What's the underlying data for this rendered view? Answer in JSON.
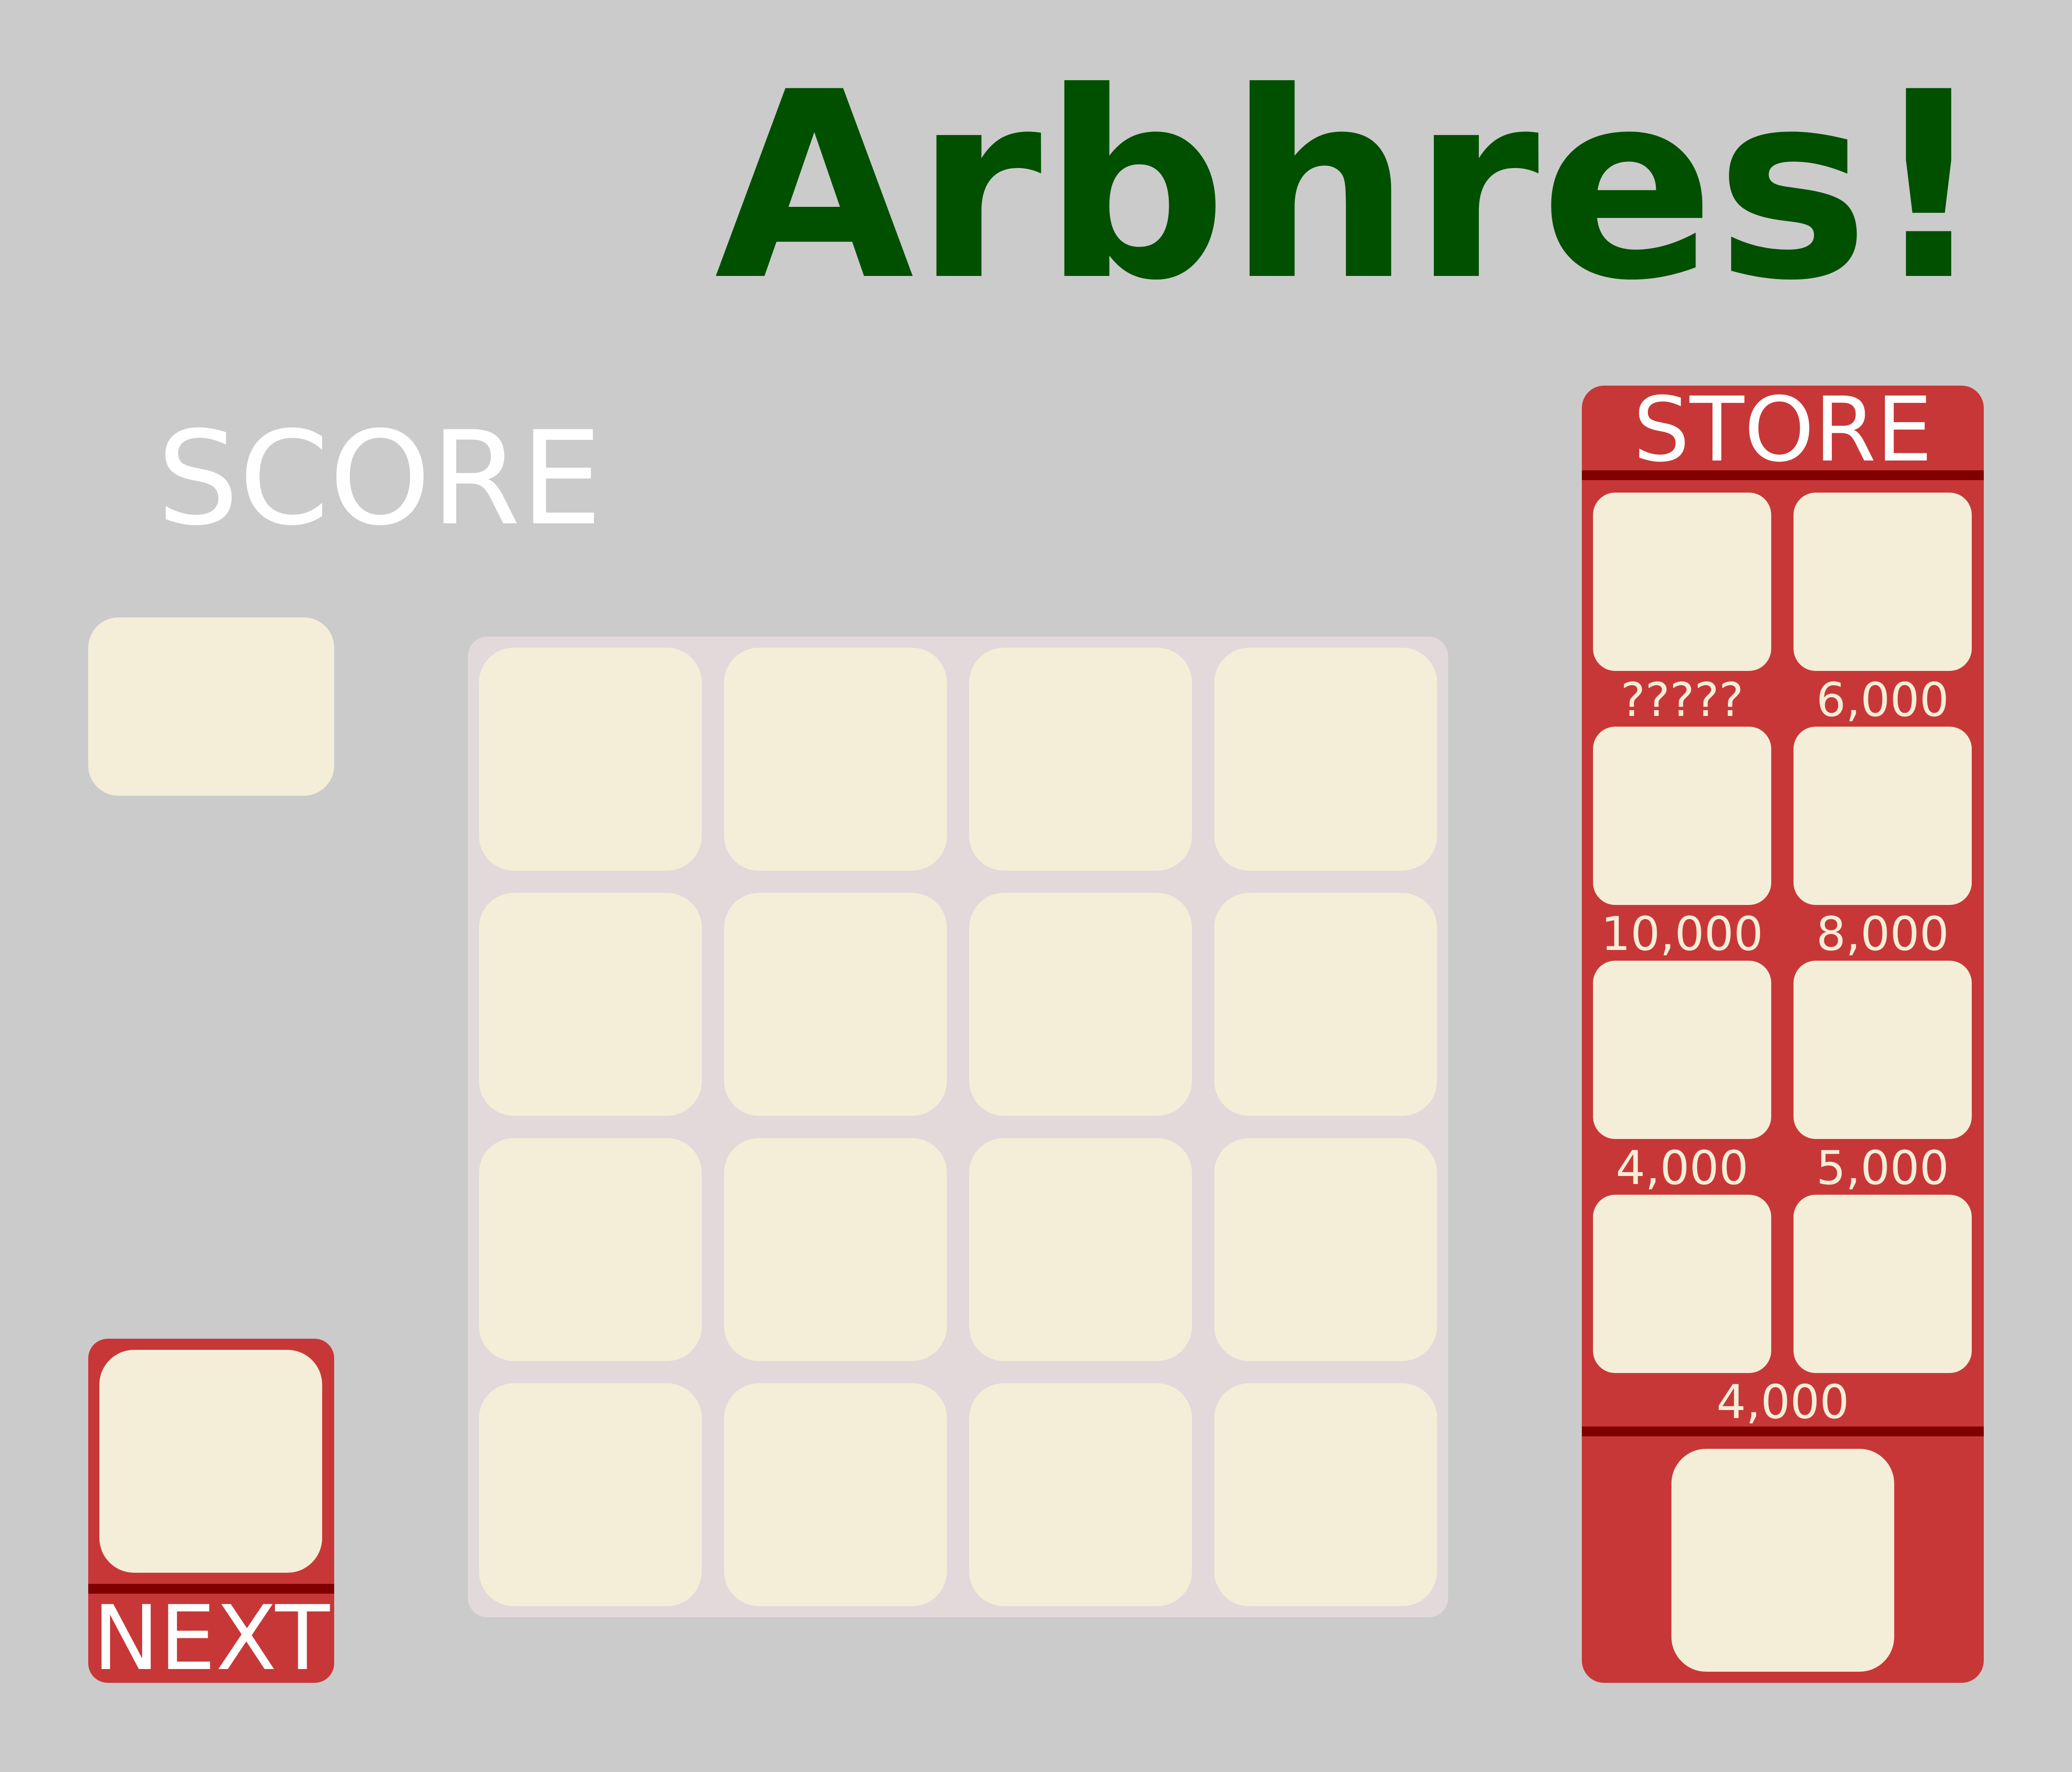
{
  "title": "Arbhres!",
  "score": {
    "label": "SCORE",
    "value": ""
  },
  "board": {
    "rows": 4,
    "cols": 4
  },
  "next": {
    "label": "NEXT"
  },
  "store": {
    "title": "STORE",
    "items": [
      {
        "price": "?????"
      },
      {
        "price": "6,000"
      },
      {
        "price": "10,000"
      },
      {
        "price": "8,000"
      },
      {
        "price": "4,000"
      },
      {
        "price": "5,000"
      },
      {
        "price": ""
      },
      {
        "price": ""
      }
    ],
    "shared_price": "4,000"
  },
  "colors": {
    "background": "#cbcbcb",
    "title": "#005000",
    "panel": "#c83737",
    "divider": "#800000",
    "tile": "#f4eed8",
    "board": "#e2d9db",
    "label_text": "#ffffff"
  }
}
